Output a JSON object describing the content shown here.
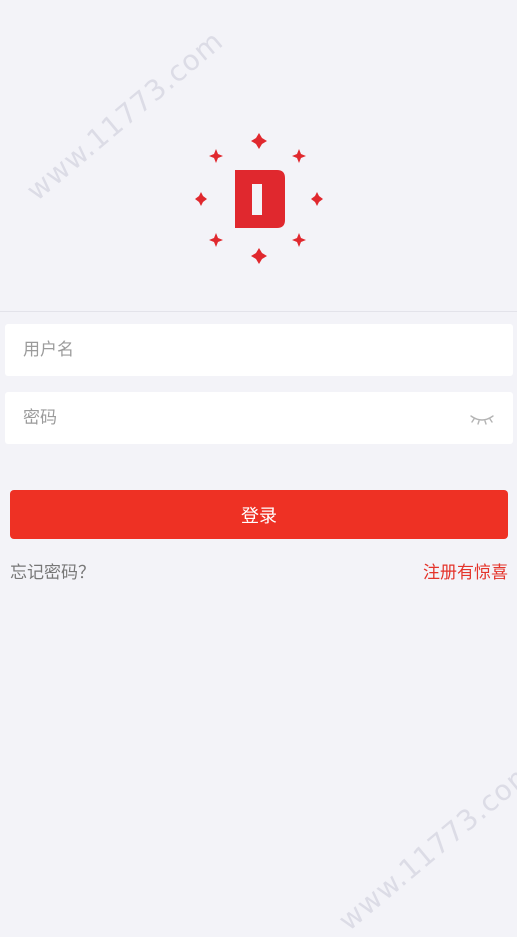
{
  "watermark": {
    "text_top": "www.11773.com",
    "text_bottom": "www.11773.com"
  },
  "logo": {
    "icon": "app-logo-icon",
    "color": "#e0282e"
  },
  "form": {
    "username": {
      "placeholder": "用户名",
      "value": ""
    },
    "password": {
      "placeholder": "密码",
      "value": "",
      "toggle_icon": "eye-closed-icon"
    },
    "login_label": "登录"
  },
  "links": {
    "forgot_password": "忘记密码？",
    "register": "注册有惊喜"
  },
  "colors": {
    "background": "#f3f3f8",
    "primary": "#ee3124",
    "link_accent": "#e4332a"
  }
}
